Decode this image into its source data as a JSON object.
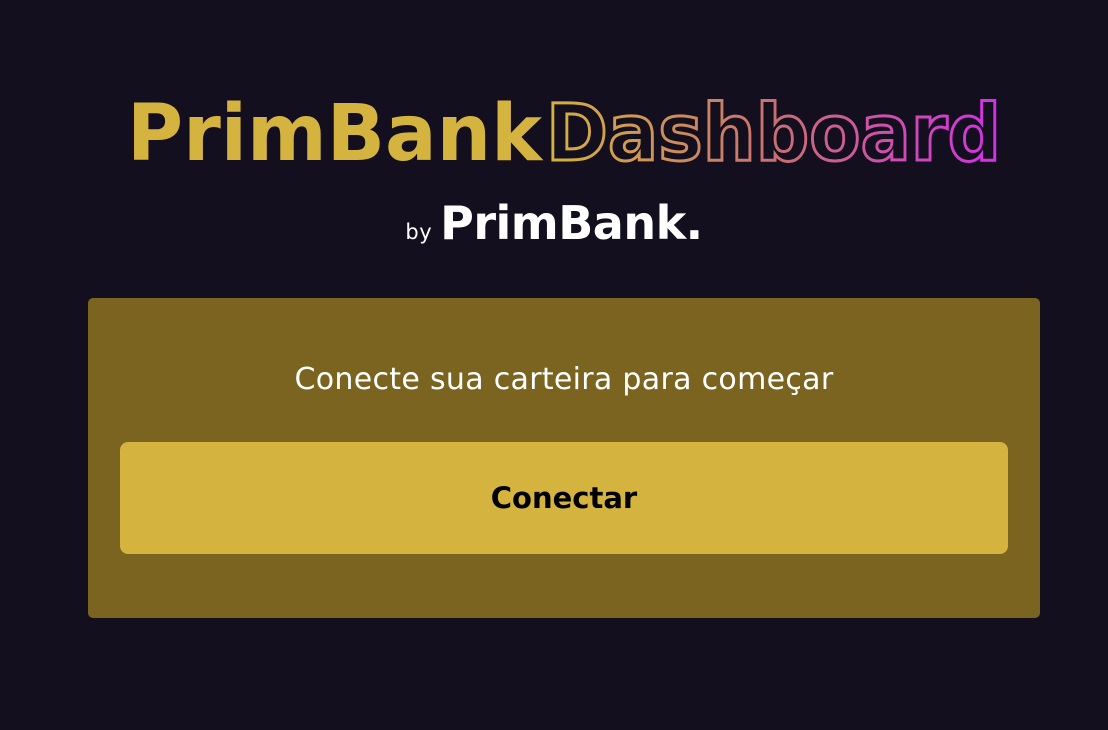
{
  "header": {
    "title_part1": "PrimBank",
    "title_part2": "Dashboard",
    "by_label": "by",
    "brand": "PrimBank."
  },
  "connect_panel": {
    "message": "Conecte sua carteira para começar",
    "button_label": "Conectar"
  },
  "colors": {
    "background": "#130f1e",
    "gold": "#d4b33f",
    "panel": "#7a6420",
    "gradient_start": "#d4b33f",
    "gradient_end": "#d42fe8"
  }
}
